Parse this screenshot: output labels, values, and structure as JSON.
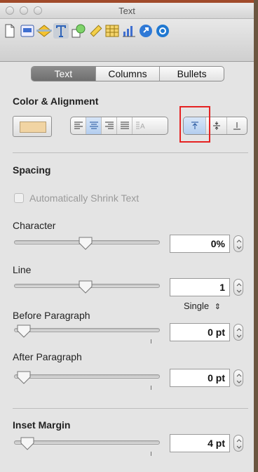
{
  "window": {
    "title": "Text"
  },
  "toolbar": {
    "icons": [
      "document-icon",
      "layout-icon",
      "wrap-icon",
      "text-icon",
      "graphic-icon",
      "metrics-icon",
      "table-icon",
      "chart-icon",
      "link-icon",
      "quicktime-icon"
    ],
    "selected": "text-icon"
  },
  "tabs": [
    {
      "label": "Text",
      "active": true
    },
    {
      "label": "Columns",
      "active": false
    },
    {
      "label": "Bullets",
      "active": false
    }
  ],
  "color_alignment": {
    "heading": "Color & Alignment",
    "swatch_color": "#f1d4a3",
    "alignment_selected": "center",
    "vertical_selected": "top"
  },
  "spacing": {
    "heading": "Spacing",
    "shrink_label": "Automatically Shrink Text",
    "character": {
      "label": "Character",
      "value": "0%",
      "slider": 0.49
    },
    "line": {
      "label": "Line",
      "value": "1",
      "slider": 0.49,
      "type": "Single"
    },
    "before": {
      "label": "Before Paragraph",
      "value": "0 pt",
      "slider": 0.02
    },
    "after": {
      "label": "After Paragraph",
      "value": "0 pt",
      "slider": 0.02
    }
  },
  "inset": {
    "heading": "Inset Margin",
    "value": "4 pt",
    "slider": 0.05
  }
}
